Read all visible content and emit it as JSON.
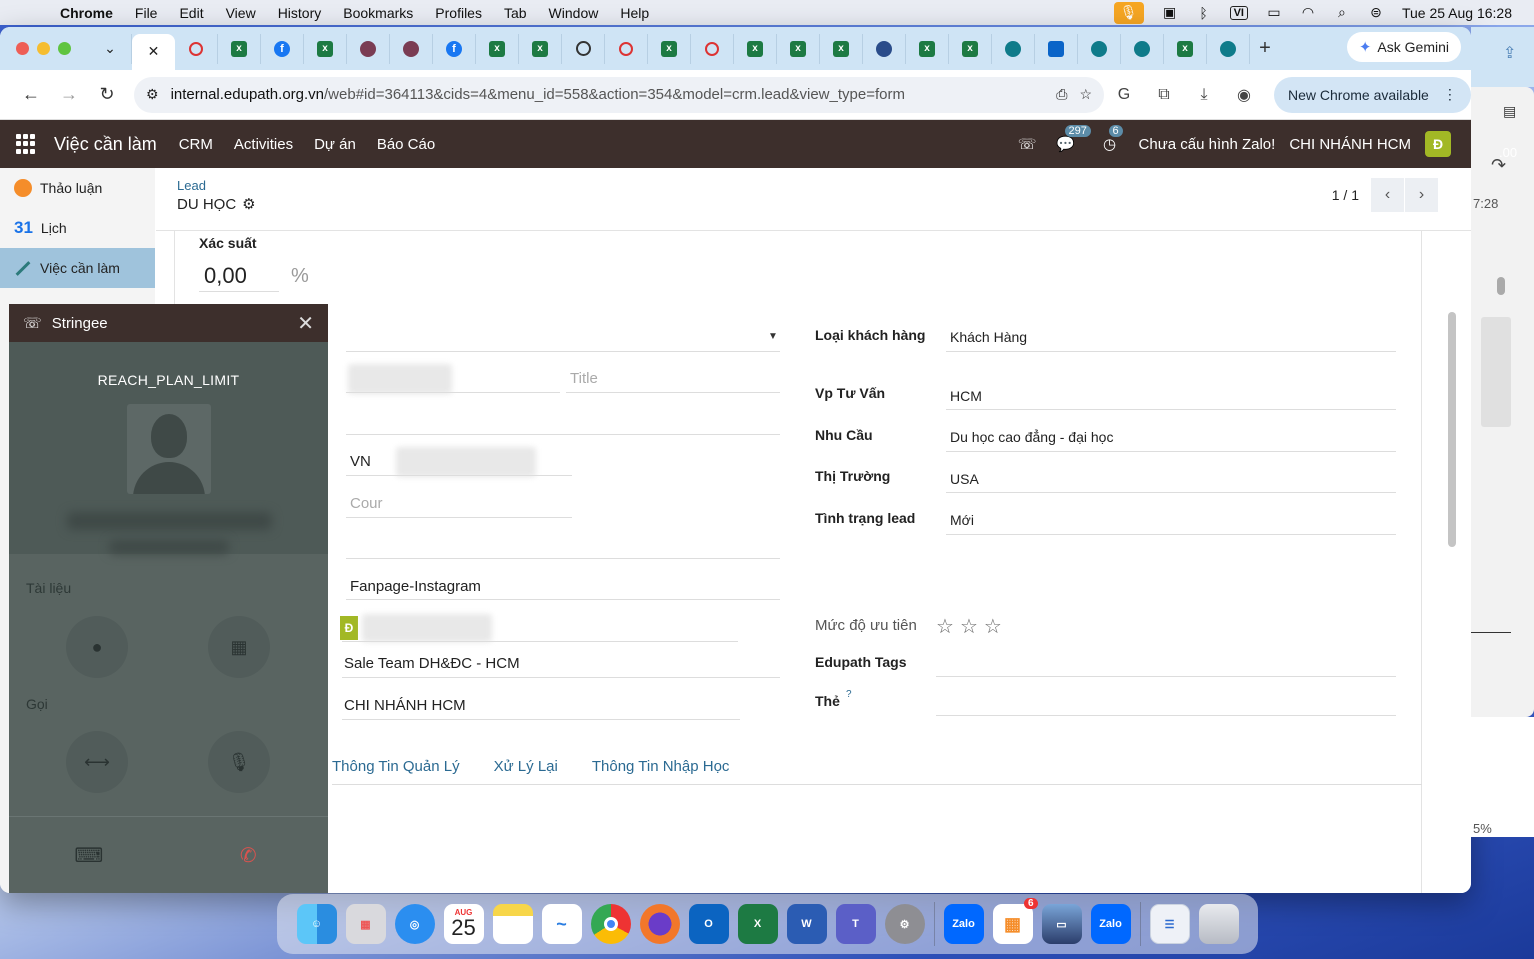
{
  "macbar": {
    "app": "Chrome",
    "menus": [
      "File",
      "Edit",
      "View",
      "History",
      "Bookmarks",
      "Profiles",
      "Tab",
      "Window",
      "Help"
    ],
    "input_source": "VI",
    "datetime": "Tue 25 Aug  16:28"
  },
  "browser": {
    "url_host": "internal.edupath.org.vn",
    "url_path": "/web#id=364113&cids=4&menu_id=558&action=354&model=crm.lead&view_type=form",
    "ask_gemini": "Ask Gemini",
    "new_chrome": "New Chrome available"
  },
  "odoo_nav": {
    "brand": "Việc cần làm",
    "menus": [
      "CRM",
      "Activities",
      "Dự án",
      "Báo Cáo"
    ],
    "messages_count": "297",
    "activities_count": "6",
    "zalo_status": "Chưa cấu hình Zalo!",
    "company": "CHI NHÁNH HCM",
    "user_initial": "Đ"
  },
  "sidebar": {
    "items": [
      {
        "label": "Thảo luận"
      },
      {
        "label": "Lịch"
      },
      {
        "label": "Việc cần làm"
      }
    ]
  },
  "breadcrumb": {
    "parent": "Lead",
    "current": "DU HỌC"
  },
  "pager": {
    "value": "1 / 1"
  },
  "form": {
    "probability_label": "Xác suất",
    "probability_value": "0,00",
    "probability_unit": "%",
    "title_placeholder": "Title",
    "country_code": "VN",
    "country_placeholder": "Cour",
    "source": "Fanpage-Instagram",
    "salesperson_initial": "Đ",
    "sales_team": "Sale Team DH&ĐC - HCM",
    "company": "CHI NHÁNH HCM",
    "right": {
      "customer_type_label": "Loại khách hàng",
      "customer_type_value": "Khách Hàng",
      "office_label": "Vp Tư Vấn",
      "office_value": "HCM",
      "need_label": "Nhu Cầu",
      "need_value": "Du học cao đẳng - đại học",
      "market_label": "Thị Trường",
      "market_value": "USA",
      "status_label": "Tình trạng lead",
      "status_value": "Mới",
      "priority_label": "Mức độ ưu tiên",
      "priority_stars": 0,
      "tags_label": "Edupath Tags",
      "the_label": "Thẻ",
      "the_help": "?"
    },
    "tabs": [
      "Thông Tin Quản Lý",
      "Xử Lý Lại",
      "Thông Tin Nhập Học"
    ]
  },
  "stringee": {
    "title": "Stringee",
    "message": "REACH_PLAN_LIMIT",
    "section_docs": "Tài liệu",
    "section_call": "Gọi"
  },
  "right_panel": {
    "time": "7:28",
    "percent": "5%",
    "value": ".00"
  },
  "dock": {
    "calendar_month": "AUG",
    "calendar_day": "25",
    "zalo_label": "Zalo",
    "store_badge": "6"
  }
}
